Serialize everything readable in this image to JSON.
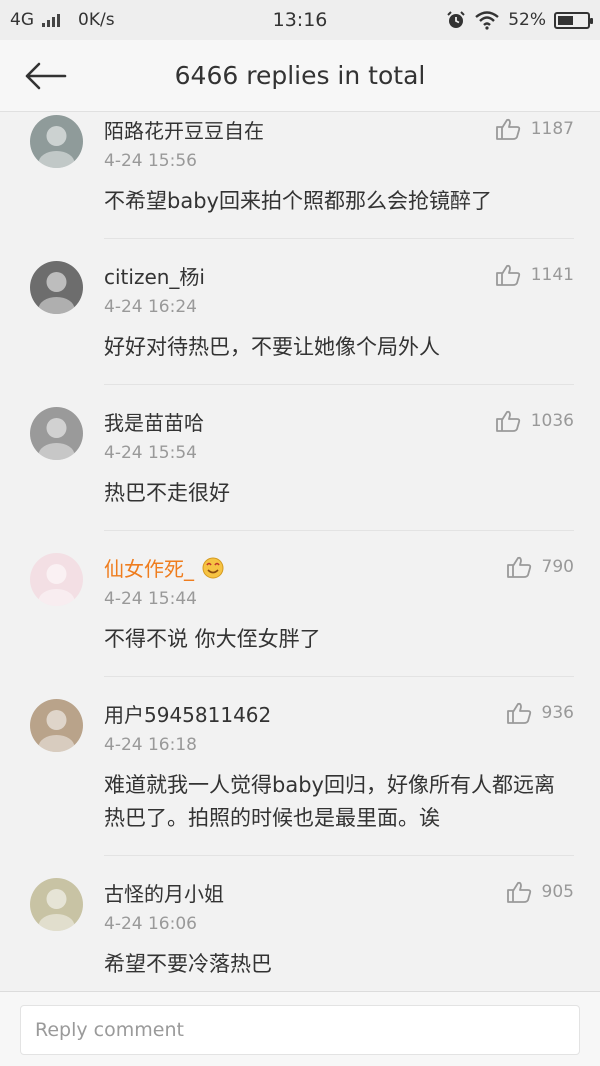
{
  "status_bar": {
    "network": "4G",
    "speed": "0K/s",
    "time": "13:16",
    "battery": "52%",
    "battery_level": 0.52
  },
  "header": {
    "title": "6466 replies in total"
  },
  "comments": [
    {
      "username": "陌路花开豆豆自在",
      "time": "4-24 15:56",
      "likes": "1187",
      "text": "不希望baby回来拍个照都那么会抢镜醉了",
      "vip": false,
      "avatar_color": "#8f9b9a"
    },
    {
      "username": "citizen_杨i",
      "time": "4-24 16:24",
      "likes": "1141",
      "text": "好好对待热巴，不要让她像个局外人",
      "vip": false,
      "avatar_color": "#6d6d6d"
    },
    {
      "username": "我是苗苗哈",
      "time": "4-24 15:54",
      "likes": "1036",
      "text": "热巴不走很好",
      "vip": false,
      "avatar_color": "#9a9a9a"
    },
    {
      "username": "仙女作死_",
      "time": "4-24 15:44",
      "likes": "790",
      "text": "不得不说 你大侄女胖了",
      "vip": true,
      "avatar_color": "#f3dfe4"
    },
    {
      "username": "用户5945811462",
      "time": "4-24 16:18",
      "likes": "936",
      "text": "难道就我一人觉得baby回归，好像所有人都远离热巴了。拍照的时候也是最里面。诶",
      "vip": false,
      "avatar_color": "#b9a38a"
    },
    {
      "username": "古怪的月小姐",
      "time": "4-24 16:06",
      "likes": "905",
      "text": "希望不要冷落热巴",
      "vip": false,
      "avatar_color": "#c8c3a4"
    }
  ],
  "reply_bar": {
    "placeholder": "Reply comment"
  },
  "icons": {
    "back": "back-arrow-icon",
    "like": "thumbs-up-icon",
    "alarm": "alarm-clock-icon",
    "wifi": "wifi-icon",
    "battery": "battery-icon",
    "signal": "signal-bars-icon"
  },
  "colors": {
    "vip_name": "#ef7d1e",
    "muted": "#999999",
    "text": "#333333",
    "background": "#f2f2f2"
  }
}
